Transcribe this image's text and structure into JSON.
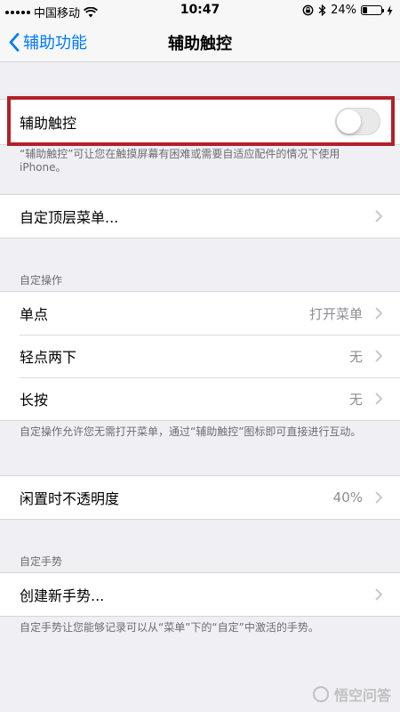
{
  "status_bar": {
    "carrier": "中国移动",
    "time": "10:47",
    "battery_percent": "24%",
    "battery_level": 0.24
  },
  "nav": {
    "back_label": "辅助功能",
    "title": "辅助触控"
  },
  "assistive_touch": {
    "label": "辅助触控",
    "enabled": false,
    "description": "“辅助触控”可让您在触摸屏幕有困难或需要自适应配件的情况下使用 iPhone。"
  },
  "top_menu": {
    "label": "自定顶层菜单..."
  },
  "custom_actions": {
    "header": "自定操作",
    "rows": [
      {
        "label": "单点",
        "value": "打开菜单"
      },
      {
        "label": "轻点两下",
        "value": "无"
      },
      {
        "label": "长按",
        "value": "无"
      }
    ],
    "footer": "自定操作允许您无需打开菜单，通过“辅助触控”图标即可直接进行互动。"
  },
  "idle_opacity": {
    "label": "闲置时不透明度",
    "value": "40%"
  },
  "custom_gestures": {
    "header": "自定手势",
    "create_label": "创建新手势...",
    "footer": "自定手势让您能够记录可以从“菜单”下的“自定”中激活的手势。"
  },
  "watermark": {
    "text": "悟空问答"
  },
  "colors": {
    "accent": "#007aff",
    "highlight": "#b3202a",
    "background": "#efeff4"
  },
  "icons": [
    "signal-icon",
    "wifi-icon",
    "lock-rotation-icon",
    "bluetooth-icon",
    "battery-icon",
    "charging-icon",
    "chevron-left-icon",
    "chevron-right-icon"
  ]
}
